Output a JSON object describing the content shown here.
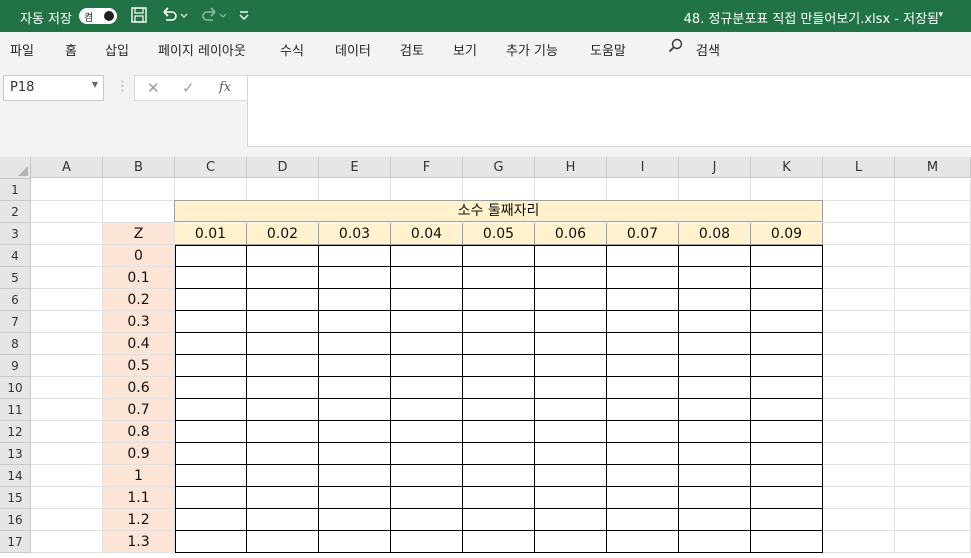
{
  "titlebar": {
    "autosave_label": "자동 저장",
    "autosave_state": "켬",
    "document": "48. 정규분포표 직접 만들어보기.xlsx  -  저장됨",
    "save_icon": "save-icon",
    "undo_icon": "undo-icon",
    "redo_icon": "redo-icon",
    "customize_icon": "customize-qat-icon"
  },
  "menu": [
    "파일",
    "홈",
    "삽입",
    "페이지 레이아웃",
    "수식",
    "데이터",
    "검토",
    "보기",
    "추가 기능",
    "도움말"
  ],
  "search": {
    "icon": "search-icon",
    "label": "검색"
  },
  "namebox": {
    "value": "P18"
  },
  "formula": {
    "value": ""
  },
  "columns": [
    "A",
    "B",
    "C",
    "D",
    "E",
    "F",
    "G",
    "H",
    "I",
    "J",
    "K",
    "L",
    "M"
  ],
  "rows": [
    "1",
    "2",
    "3",
    "4",
    "5",
    "6",
    "7",
    "8",
    "9",
    "10",
    "11",
    "12",
    "13",
    "14",
    "15",
    "16",
    "17"
  ],
  "table": {
    "title": "소수 둘째자리",
    "z_header": "Z",
    "col_headers": [
      "0.01",
      "0.02",
      "0.03",
      "0.04",
      "0.05",
      "0.06",
      "0.07",
      "0.08",
      "0.09"
    ],
    "z_values": [
      "0",
      "0.1",
      "0.2",
      "0.3",
      "0.4",
      "0.5",
      "0.6",
      "0.7",
      "0.8",
      "0.9",
      "1",
      "1.1",
      "1.2",
      "1.3"
    ]
  },
  "colors": {
    "accent": "#217346",
    "header_fill": "#fff2cc",
    "z_fill": "#fce4d6"
  }
}
